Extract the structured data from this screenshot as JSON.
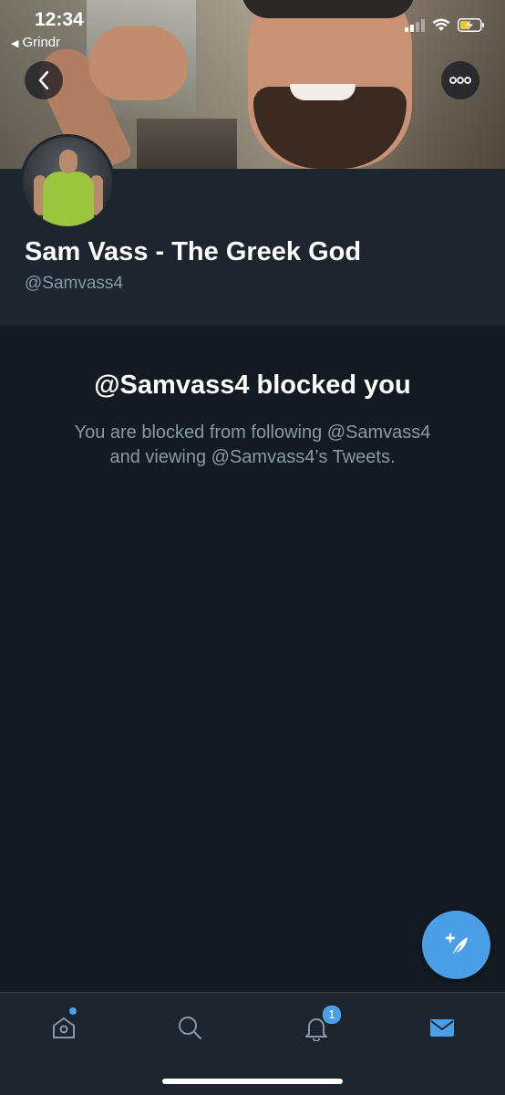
{
  "status_bar": {
    "time": "12:34",
    "back_app": "Grindr",
    "icons": [
      "signal-icon",
      "wifi-icon",
      "battery-charging-icon"
    ]
  },
  "header": {
    "back_icon": "chevron-left-icon",
    "more_icon": "ellipsis-icon"
  },
  "profile": {
    "display_name": "Sam Vass - The Greek God",
    "handle": "@Samvass4"
  },
  "blocked": {
    "title": "@Samvass4 blocked you",
    "line1": "You are blocked from following @Samvass4",
    "line2": "and viewing @Samvass4’s Tweets."
  },
  "fab": {
    "icon": "compose-tweet-icon"
  },
  "tabbar": {
    "tabs": [
      {
        "name": "home",
        "icon": "home-icon",
        "has_dot": true
      },
      {
        "name": "search",
        "icon": "search-icon"
      },
      {
        "name": "notifications",
        "icon": "bell-icon",
        "badge": "1"
      },
      {
        "name": "messages",
        "icon": "envelope-icon",
        "active": true
      }
    ]
  },
  "colors": {
    "background": "#141a22",
    "profile_bg": "#1d252f",
    "accent": "#4a9fe6",
    "secondary_text": "#8899a6"
  }
}
